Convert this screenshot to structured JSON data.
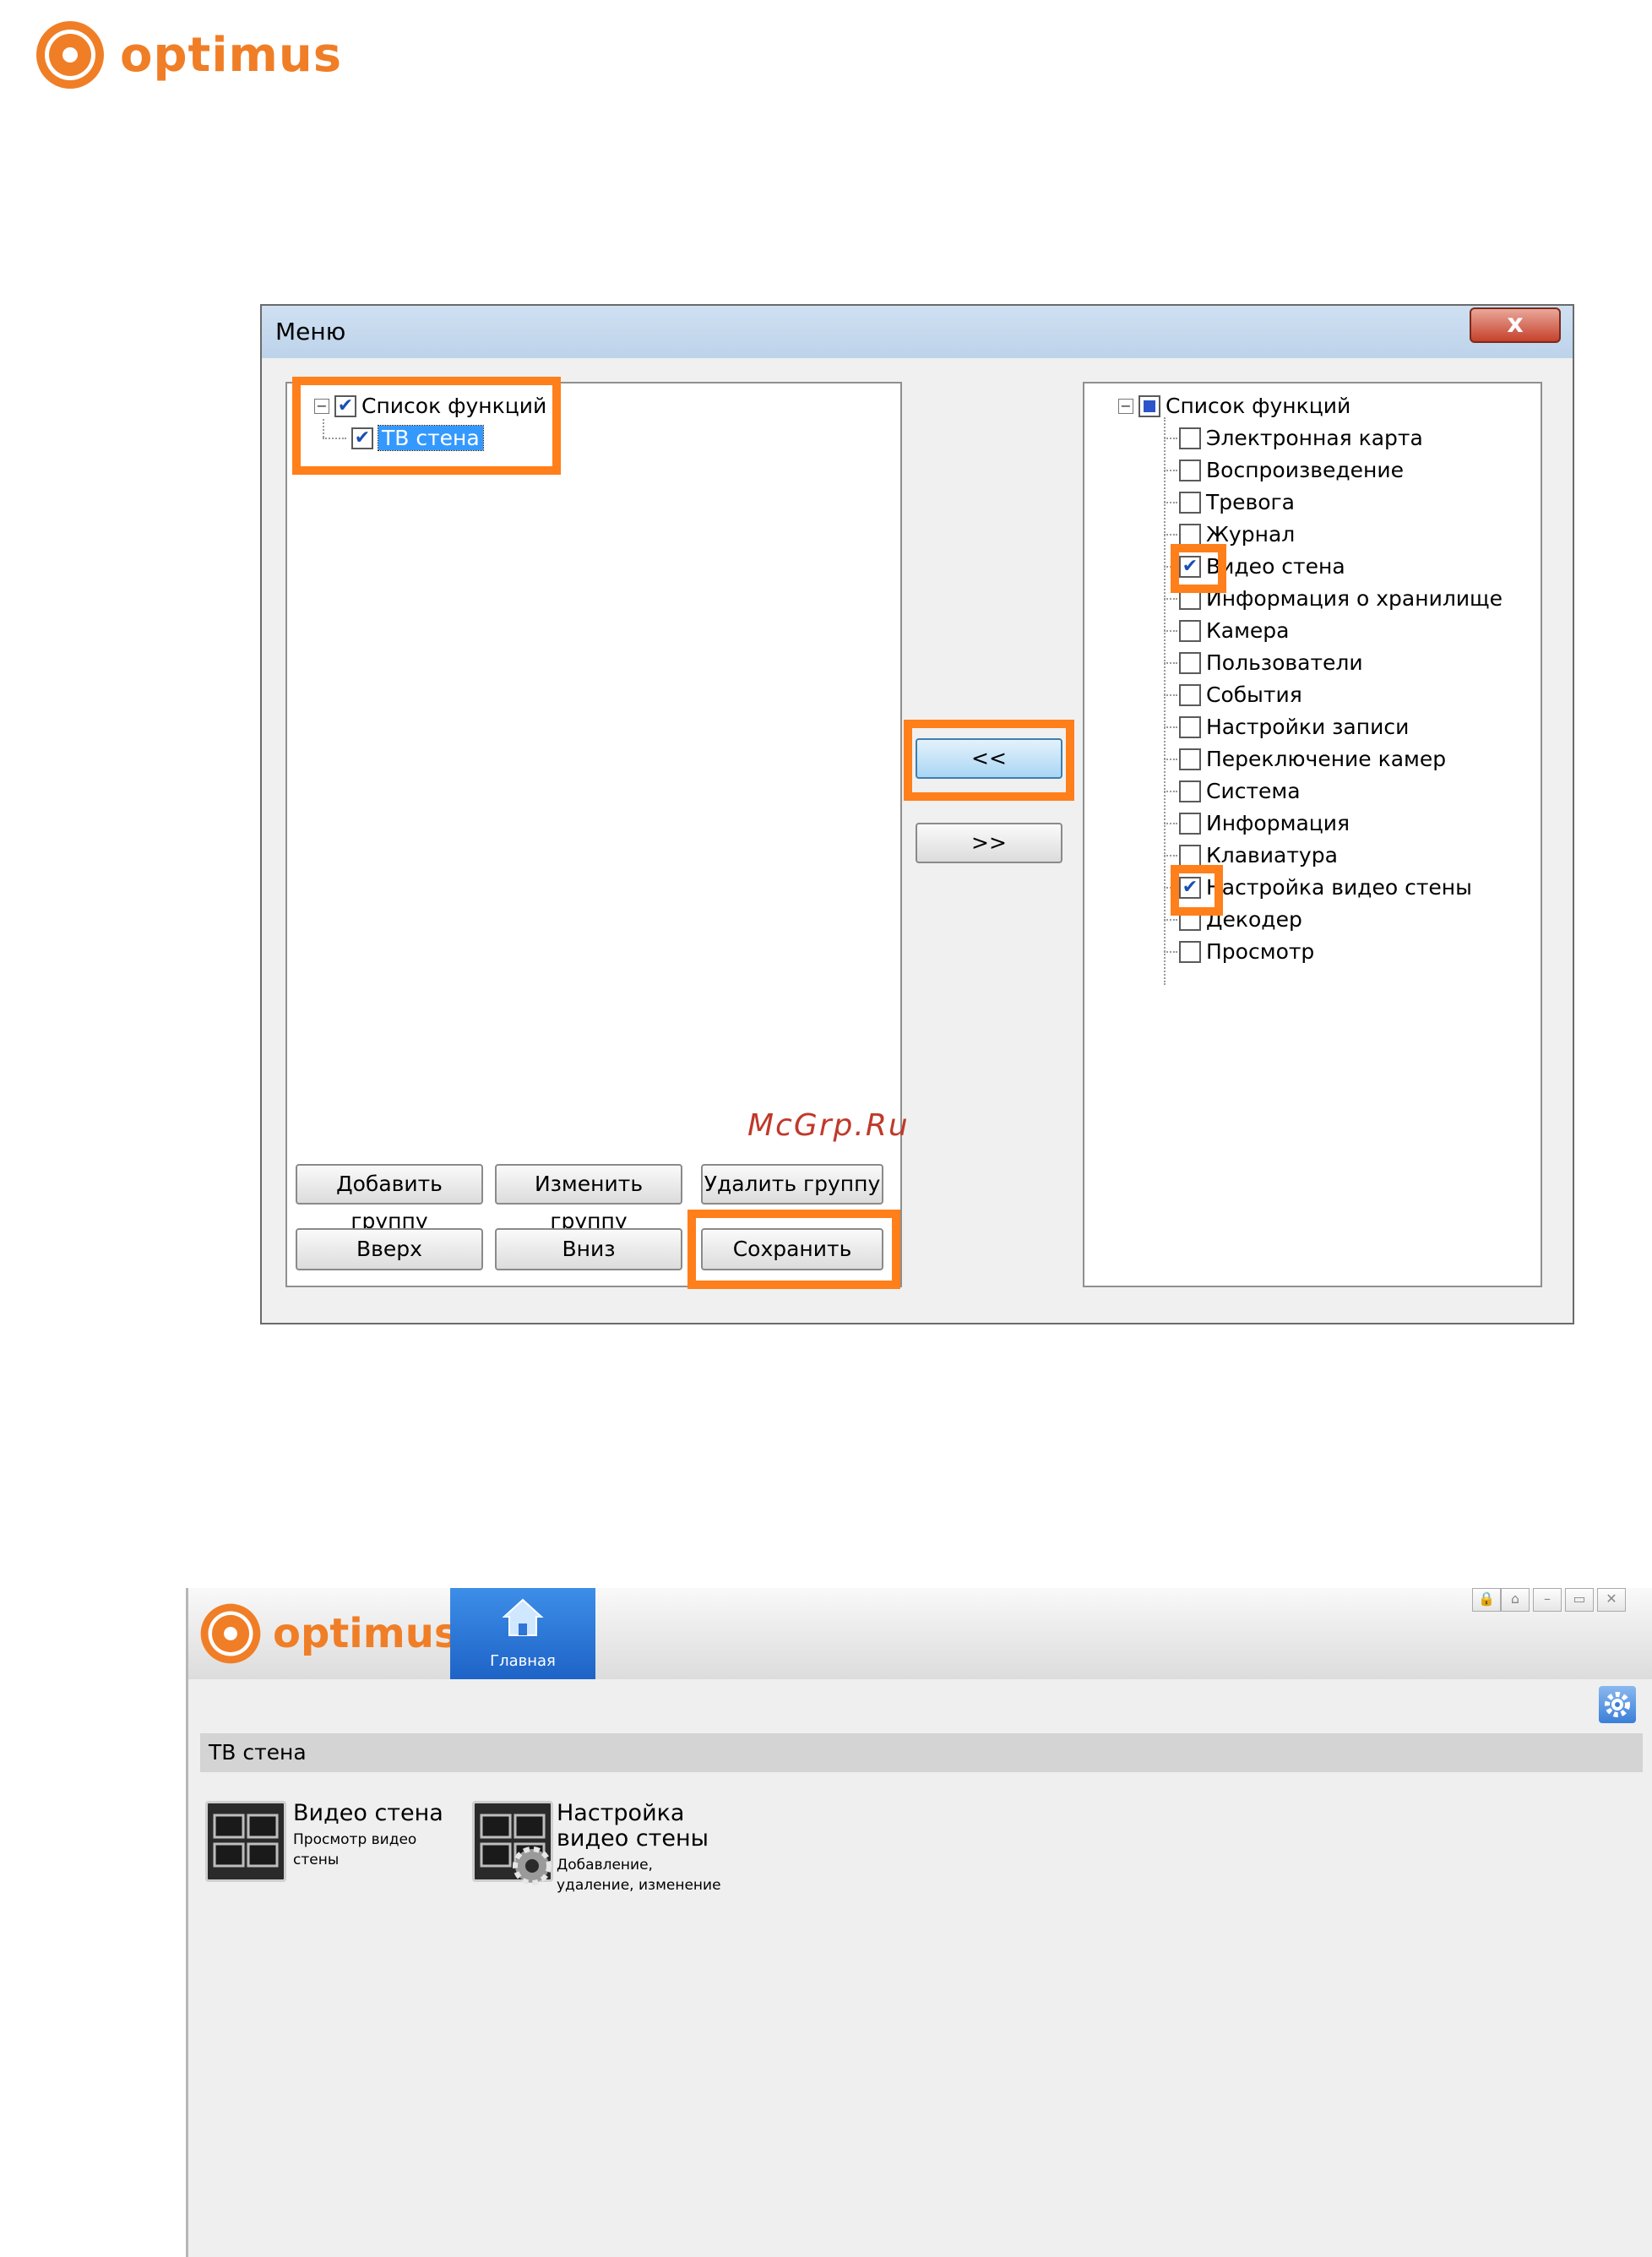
{
  "brand": {
    "name": "optimus",
    "color": "#f07e26"
  },
  "dialog": {
    "title": "Меню",
    "close_label": "x",
    "left_tree": {
      "root": "Список функций",
      "items": [
        "ТВ стена"
      ]
    },
    "right_tree": {
      "root": "Список функций",
      "items": [
        {
          "label": "Электронная карта",
          "checked": false
        },
        {
          "label": "Воспроизведение",
          "checked": false
        },
        {
          "label": "Тревога",
          "checked": false
        },
        {
          "label": "Журнал",
          "checked": false
        },
        {
          "label": "Видео стена",
          "checked": true
        },
        {
          "label": "Информация о хранилище",
          "checked": false
        },
        {
          "label": "Камера",
          "checked": false
        },
        {
          "label": "Пользователи",
          "checked": false
        },
        {
          "label": "События",
          "checked": false
        },
        {
          "label": "Настройки записи",
          "checked": false
        },
        {
          "label": "Переключение камер",
          "checked": false
        },
        {
          "label": "Система",
          "checked": false
        },
        {
          "label": "Информация",
          "checked": false
        },
        {
          "label": "Клавиатура",
          "checked": false
        },
        {
          "label": "Настройка видео стены",
          "checked": true
        },
        {
          "label": "Декодер",
          "checked": false
        },
        {
          "label": "Просмотр",
          "checked": false
        }
      ]
    },
    "move_left_label": "<<",
    "move_right_label": ">>",
    "buttons": {
      "add_group": "Добавить группу",
      "edit_group": "Изменить группу",
      "delete_group": "Удалить группу",
      "up": "Вверх",
      "down": "Вниз",
      "save": "Сохранить"
    },
    "check_mark": "✔"
  },
  "watermark": "McGrp.Ru",
  "app": {
    "brand": "optimus",
    "home_tab": "Главная",
    "window_controls": [
      "🔒",
      "⌂",
      "–",
      "▭",
      "✕"
    ],
    "group_title": "ТВ стена",
    "tiles": [
      {
        "title": "Видео стена",
        "desc": "Просмотр видео стены"
      },
      {
        "title_line1": "Настройка",
        "title_line2": "видео стены",
        "desc_line1": "Добавление,",
        "desc_line2": "удаление, изменение"
      }
    ],
    "highlight_color": "#ff7f1a"
  }
}
